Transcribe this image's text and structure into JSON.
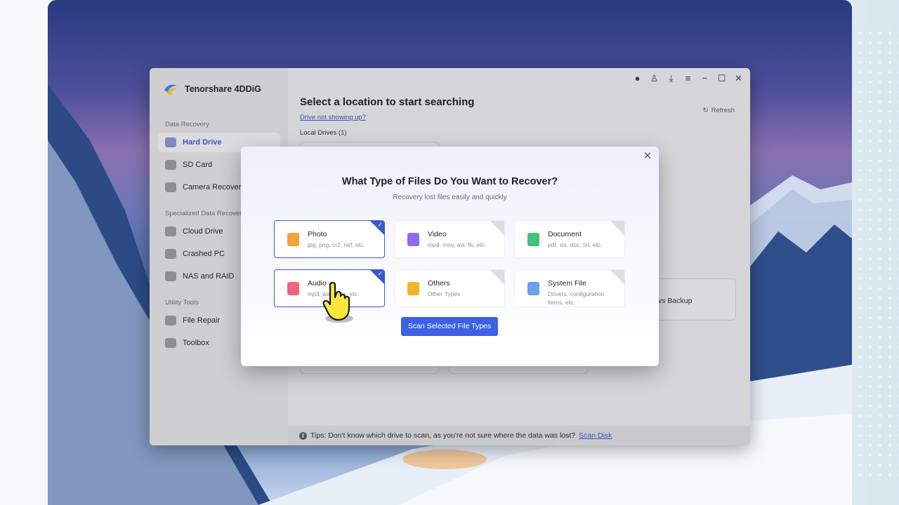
{
  "app": {
    "brand_name": "Tenorshare 4DDiG"
  },
  "sidebar": {
    "sections": [
      {
        "label": "Data Recovery"
      },
      {
        "label": "Specialized Data Recovery"
      },
      {
        "label": "Utility Tools"
      }
    ],
    "items": [
      {
        "label": "Hard Drive",
        "icon": "hard-drive-icon",
        "active": true
      },
      {
        "label": "SD Card",
        "icon": "sd-card-icon"
      },
      {
        "label": "Camera Recovery",
        "icon": "camera-icon"
      },
      {
        "label": "Cloud Drive",
        "icon": "cloud-icon"
      },
      {
        "label": "Crashed PC",
        "icon": "crashed-pc-icon"
      },
      {
        "label": "NAS and RAID",
        "icon": "nas-icon"
      },
      {
        "label": "File Repair",
        "icon": "file-repair-icon"
      },
      {
        "label": "Toolbox",
        "icon": "toolbox-icon"
      }
    ]
  },
  "main": {
    "title": "Select a location to start searching",
    "drive_link": "Drive not showing up?",
    "local_drives": "Local Drives (1)",
    "refresh_label": "Refresh",
    "ghost_card_text": "vs Backup"
  },
  "tips": {
    "text": "Tips: Don't know which drive to scan, as you're not sure where the data was lost?",
    "link": "Scan Disk"
  },
  "modal": {
    "title": "What Type of Files Do You Want to Recover?",
    "subtitle": "Recovery lost files easily and quickly",
    "file_types": [
      {
        "name": "Photo",
        "desc": "jpg, png, cr2, nef, etc.",
        "selected": true,
        "icon_color": "#f5a03a"
      },
      {
        "name": "Video",
        "desc": "mp4, mov, avi, flv, etc.",
        "selected": false,
        "icon_color": "#8a6cf0"
      },
      {
        "name": "Document",
        "desc": "pdf, xls, doc, txt, etc.",
        "selected": false,
        "icon_color": "#3fc27a"
      },
      {
        "name": "Audio",
        "desc": "mp3, wav, ape, etc.",
        "selected": true,
        "icon_color": "#f0657b"
      },
      {
        "name": "Others",
        "desc": "Other Types",
        "selected": false,
        "icon_color": "#f3b32c"
      },
      {
        "name": "System File",
        "desc": "Drivers, configuration items, etc.",
        "selected": false,
        "icon_color": "#6aa0ee"
      }
    ],
    "scan_button": "Scan Selected File Types",
    "check_glyph": "✓",
    "close_glyph": "✕"
  },
  "colors": {
    "accent": "#3d60e6",
    "selected_border": "#3d56cf"
  }
}
